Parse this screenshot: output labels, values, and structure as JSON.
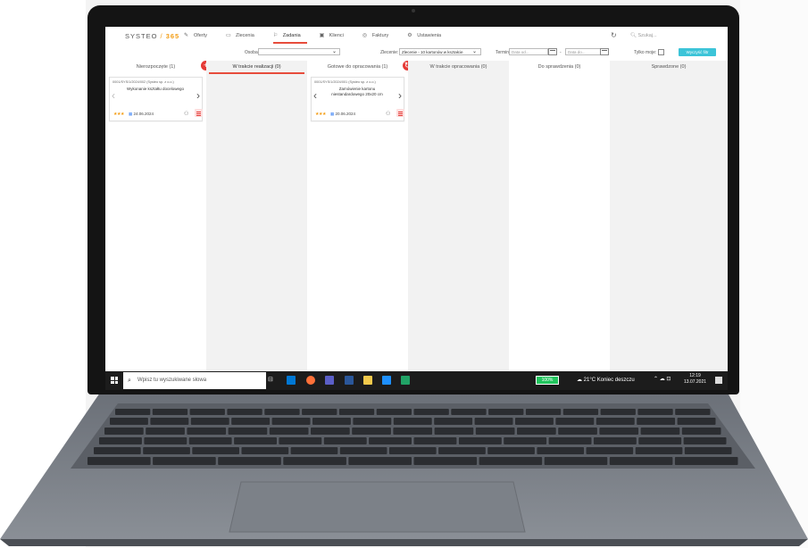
{
  "app": {
    "brand_prefix": "SYSTEO",
    "brand_slash": "/",
    "brand_num": "365"
  },
  "nav": [
    {
      "label": "Oferty",
      "icon": "edit-icon"
    },
    {
      "label": "Zlecenia",
      "icon": "folder-icon"
    },
    {
      "label": "Zadania",
      "icon": "flag-icon",
      "active": true
    },
    {
      "label": "Klienci",
      "icon": "contacts-icon"
    },
    {
      "label": "Faktury",
      "icon": "invoice-icon"
    },
    {
      "label": "Ustawienia",
      "icon": "gear-icon"
    }
  ],
  "search": {
    "placeholder": "Szukaj..."
  },
  "filters": {
    "person_label": "Osoba:",
    "person_value": "",
    "order_label": "Zlecenie:",
    "order_value": "Zlecenie - 10 kartonów w kształcie",
    "term_label": "Termin:",
    "date_from_placeholder": "Data od...",
    "date_sep": "-",
    "date_to_placeholder": "Data do...",
    "only_mine_label": "Tylko moje:",
    "clear_button": "Wyczyść filtr"
  },
  "columns": [
    {
      "title": "Nierozpoczęte (1)"
    },
    {
      "title": "W trakcie realizacji (0)",
      "active": true
    },
    {
      "title": "Gotowe do opracowania (1)"
    },
    {
      "title": "W trakcie opracowania (0)"
    },
    {
      "title": "Do sprawdzenia (0)"
    },
    {
      "title": "Sprawdzone (0)"
    }
  ],
  "cards": [
    {
      "code": "0001/SYS/1/2024/002 (Systeo sp. z o.o.)",
      "title": "Wykonanie kształtu docelowego",
      "stars": "★★★",
      "date": "24.06.2024"
    },
    {
      "code": "0001/SYS/1/2024/001 (Systeo sp. z o.o.)",
      "title": "Zamówienie kartonu niestandardowego 20x20 cm",
      "stars": "★★★",
      "date": "20.06.2024"
    }
  ],
  "taskbar": {
    "search_placeholder": "Wpisz tu wyszukiwane słowa",
    "battery": "100%",
    "weather": "21°C  Koniec deszczu",
    "time": "12:19",
    "date": "13.07.2021"
  },
  "colors": {
    "accent": "#e74c3c",
    "brand_orange": "#f39c12",
    "clear_button": "#3cc4d8",
    "battery": "#22c55e"
  }
}
